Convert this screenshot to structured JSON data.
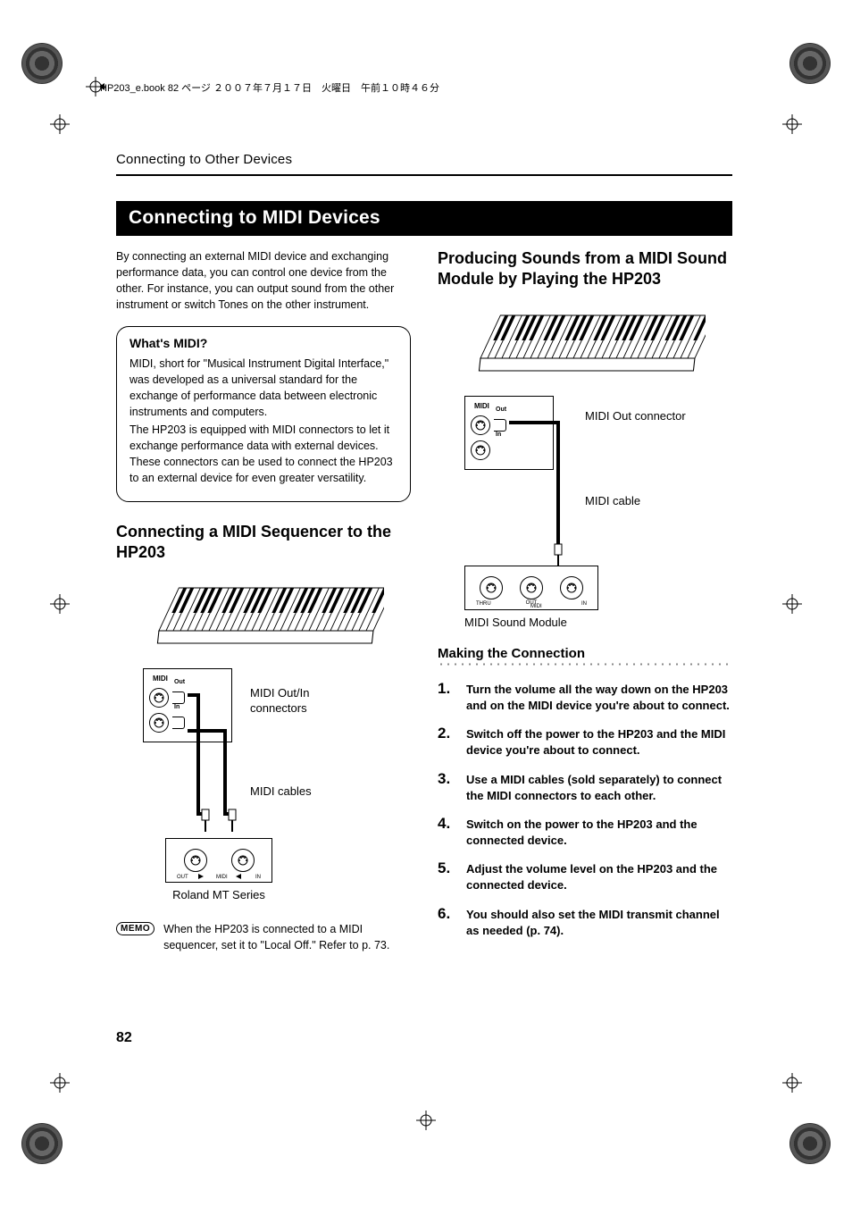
{
  "header_line": "HP203_e.book 82 ページ ２００７年７月１７日　火曜日　午前１０時４６分",
  "running_head": "Connecting to Other Devices",
  "section_title": "Connecting to MIDI Devices",
  "intro": "By connecting an external MIDI device and exchanging performance data, you can control one device from the other. For instance, you can output sound from the other instrument or switch Tones on the other instrument.",
  "info": {
    "title": "What's MIDI?",
    "p1": "MIDI, short for \"Musical Instrument Digital Interface,\" was developed as a universal standard for the exchange of performance data between electronic instruments and computers.",
    "p2": "The HP203 is equipped with MIDI connectors to let it exchange performance data with external devices. These connectors can be used to connect the HP203 to an external device for even greater versatility."
  },
  "left_subhead": "Connecting a MIDI Sequencer to the HP203",
  "left_diagram": {
    "midi_label": "MIDI",
    "out_label": "Out",
    "in_label": "In",
    "conn_label": "MIDI Out/In connectors",
    "cables_label": "MIDI cables",
    "module_out": "OUT",
    "module_midi": "MIDI",
    "module_in": "IN",
    "module_caption": "Roland MT Series"
  },
  "memo": {
    "icon": "MEMO",
    "text": "When the HP203 is connected to a MIDI sequencer, set it to \"Local Off.\" Refer to p. 73."
  },
  "right_subhead": "Producing Sounds from a MIDI Sound Module by Playing the HP203",
  "right_diagram": {
    "midi_label": "MIDI",
    "out_label": "Out",
    "in_label": "In",
    "out_conn": "MIDI Out connector",
    "cable_label": "MIDI cable",
    "module_thru": "THRU",
    "module_out": "OUT",
    "module_in": "IN",
    "module_midi": "MIDI",
    "module_caption": "MIDI Sound Module"
  },
  "steps_title": "Making the Connection",
  "steps": [
    "Turn the volume all the way down on the HP203 and on the MIDI device you're about to connect.",
    "Switch off the power to the HP203 and the MIDI device you're about to connect.",
    "Use a MIDI cables (sold separately) to connect the MIDI connectors to each other.",
    "Switch on the power to the HP203 and the connected device.",
    "Adjust the volume level on the HP203 and the connected device.",
    "You should also set the MIDI transmit channel as needed (p. 74)."
  ],
  "page_number": "82"
}
